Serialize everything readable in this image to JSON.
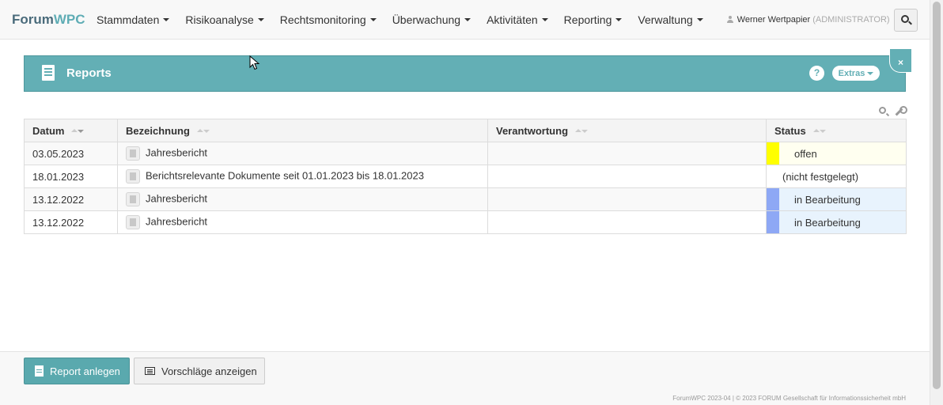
{
  "app": {
    "brand_part1": "Forum",
    "brand_part2": "WPC"
  },
  "nav": {
    "items": [
      {
        "label": "Stammdaten"
      },
      {
        "label": "Risikoanalyse"
      },
      {
        "label": "Rechtsmonitoring"
      },
      {
        "label": "Überwachung"
      },
      {
        "label": "Aktivitäten"
      },
      {
        "label": "Reporting"
      },
      {
        "label": "Verwaltung"
      }
    ],
    "user_name": "Werner Wertpapier",
    "user_role": "(ADMINISTRATOR)"
  },
  "panel": {
    "title": "Reports",
    "help_label": "?",
    "extras_label": "Extras",
    "close_label": "×"
  },
  "table": {
    "columns": [
      "Datum",
      "Bezeichnung",
      "Verantwortung",
      "Status"
    ],
    "rows": [
      {
        "datum": "03.05.2023",
        "bezeichnung": "Jahresbericht",
        "verantwortung": "",
        "status": "offen"
      },
      {
        "datum": "18.01.2023",
        "bezeichnung": "Berichtsrelevante Dokumente seit 01.01.2023 bis 18.01.2023",
        "verantwortung": "",
        "status": "(nicht festgelegt)"
      },
      {
        "datum": "13.12.2022",
        "bezeichnung": "Jahresbericht",
        "verantwortung": "",
        "status": "in Bearbeitung"
      },
      {
        "datum": "13.12.2022",
        "bezeichnung": "Jahresbericht",
        "verantwortung": "",
        "status": "in Bearbeitung"
      }
    ]
  },
  "status_colors": {
    "offen": "#ffff00",
    "in_bearbeitung": "#8ea8f5"
  },
  "colors": {
    "accent": "#63afb5"
  },
  "footer": {
    "primary_button": "Report anlegen",
    "secondary_button": "Vorschläge anzeigen",
    "copyright": "ForumWPC 2023-04  |  © 2023 FORUM Gesellschaft für Informationssicherheit mbH"
  }
}
